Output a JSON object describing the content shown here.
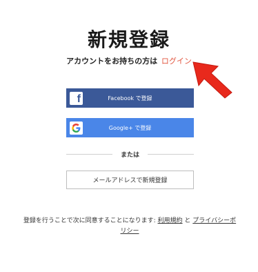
{
  "header": {
    "title": "新規登録",
    "login_prompt": "アカウントをお持ちの方は",
    "login_link": "ログイン"
  },
  "buttons": {
    "facebook_label": "Facebook で登録",
    "google_label": "Google+ で登録",
    "email_label": "メールアドレスで新規登録"
  },
  "divider": {
    "text": "または"
  },
  "terms": {
    "prefix": "登録を行うことで次に同意することになります:",
    "terms_link": "利用規約",
    "conjunction": "と",
    "privacy_link": "プライバシーポリシー"
  },
  "colors": {
    "login_link": "#e2553f",
    "facebook": "#3b5998",
    "google": "#4a86e8",
    "arrow": "#e8291c"
  },
  "icons": {
    "facebook": "facebook-icon",
    "google": "google-icon",
    "arrow": "red-arrow-icon"
  }
}
